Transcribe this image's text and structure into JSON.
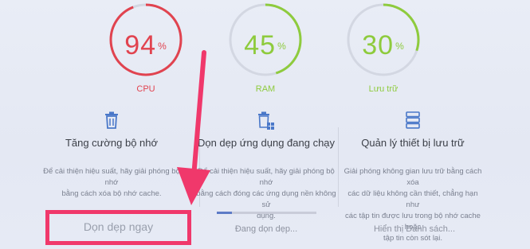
{
  "gauges": [
    {
      "value": "94",
      "unit": "%",
      "label": "CPU",
      "color": "#e1434f",
      "level": 0.94
    },
    {
      "value": "45",
      "unit": "%",
      "label": "RAM",
      "color": "#8ecb3d",
      "level": 0.45
    },
    {
      "value": "30",
      "unit": "%",
      "label": "Lưu trữ",
      "color": "#8ecb3d",
      "level": 0.3
    }
  ],
  "sections": [
    {
      "icon": "trash-icon",
      "title": "Tăng cường bộ nhớ",
      "desc_lines": [
        "Để cải thiện hiệu suất, hãy giải phóng bộ nhớ",
        "bằng cách xóa bộ nhớ cache."
      ],
      "button_label": "Dọn dẹp ngay"
    },
    {
      "icon": "apps-cleanup-icon",
      "title": "Dọn dẹp ứng dụng đang chạy",
      "desc_lines": [
        "Để cải thiện hiệu suất, hãy giải phóng bộ nhớ",
        "bằng cách đóng các ứng dụng nền không sử",
        "dụng."
      ],
      "button_label": "Đang dọn dẹp...",
      "progress": 0.15
    },
    {
      "icon": "storage-icon",
      "title": "Quản lý thiết bị lưu trữ",
      "desc_lines": [
        "Giải phóng không gian lưu trữ bằng cách xóa",
        "các dữ liệu không cần thiết, chẳng hạn như",
        "các tập tin được lưu trong bộ nhớ cache hoặc",
        "tập tin còn sót lại."
      ],
      "button_label": "Hiển thị Danh sách..."
    }
  ],
  "colors": {
    "highlight": "#f0386b",
    "arrow": "#f0386b",
    "cpu": "#e1434f",
    "ram_storage": "#8ecb3d",
    "gauge_track": "#d3d7e2",
    "progress_fill": "#5d7bc7"
  }
}
